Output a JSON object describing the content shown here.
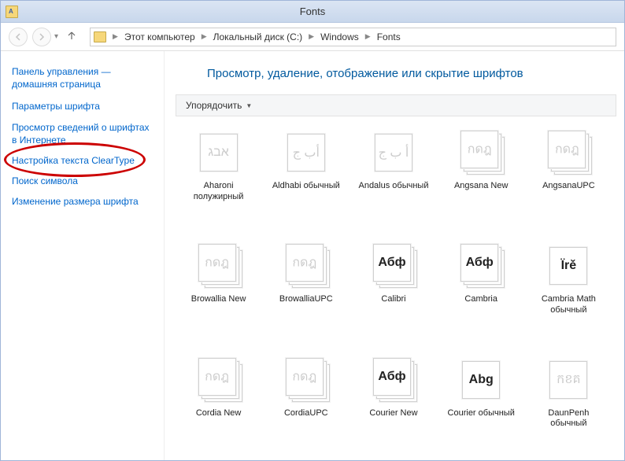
{
  "window": {
    "title": "Fonts"
  },
  "breadcrumb": {
    "items": [
      "Этот компьютер",
      "Локальный диск (C:)",
      "Windows",
      "Fonts"
    ]
  },
  "sidebar": {
    "head": "Панель управления — домашняя страница",
    "links": [
      "Параметры шрифта",
      "Просмотр сведений о шрифтах в Интернете",
      "Настройка текста ClearType",
      "Поиск символа",
      "Изменение размера шрифта"
    ]
  },
  "main": {
    "title": "Просмотр, удаление, отображение или скрытие шрифтов",
    "toolbar": {
      "organize": "Упорядочить"
    }
  },
  "fonts": [
    {
      "name": "Aharoni полужирный",
      "glyph": "אבג",
      "style": "light",
      "stack": false
    },
    {
      "name": "Aldhabi обычный",
      "glyph": "أب ج",
      "style": "light",
      "stack": false
    },
    {
      "name": "Andalus обычный",
      "glyph": "أ ب ج",
      "style": "light",
      "stack": false
    },
    {
      "name": "Angsana New",
      "glyph": "กดฎ",
      "style": "light",
      "stack": true
    },
    {
      "name": "AngsanaUPC",
      "glyph": "กดฎ",
      "style": "light",
      "stack": true
    },
    {
      "name": "Browallia New",
      "glyph": "กดฎ",
      "style": "light",
      "stack": true
    },
    {
      "name": "BrowalliaUPC",
      "glyph": "กดฎ",
      "style": "light",
      "stack": true
    },
    {
      "name": "Calibri",
      "glyph": "Абф",
      "style": "dark",
      "stack": true
    },
    {
      "name": "Cambria",
      "glyph": "Абф",
      "style": "dark",
      "stack": true
    },
    {
      "name": "Cambria Math обычный",
      "glyph": "Ïrě",
      "style": "dark",
      "stack": false
    },
    {
      "name": "Cordia New",
      "glyph": "กดฎ",
      "style": "light",
      "stack": true
    },
    {
      "name": "CordiaUPC",
      "glyph": "กดฎ",
      "style": "light",
      "stack": true
    },
    {
      "name": "Courier New",
      "glyph": "Абф",
      "style": "dark",
      "stack": true
    },
    {
      "name": "Courier обычный",
      "glyph": "Abg",
      "style": "dark",
      "stack": false
    },
    {
      "name": "DaunPenh обычный",
      "glyph": "កខគ",
      "style": "light",
      "stack": false
    }
  ]
}
